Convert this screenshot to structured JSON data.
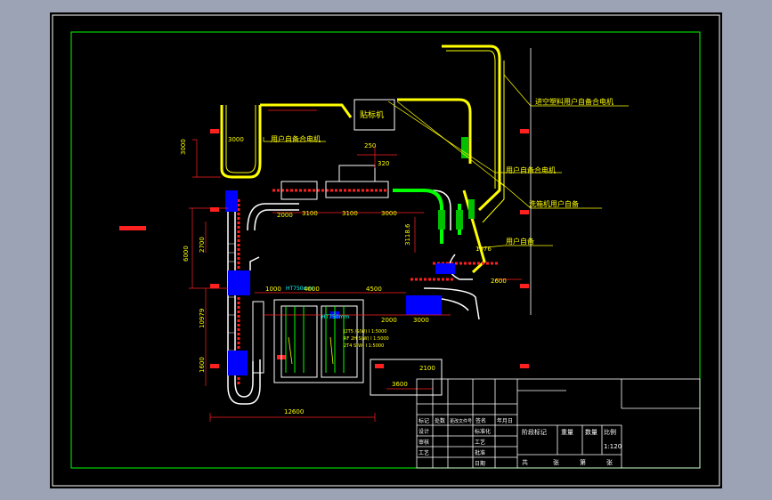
{
  "drawing": {
    "callouts": {
      "vacuum_oiler_motor": "进空塑料用户自备合电机",
      "own_motor_a": "用户自备合电机",
      "own_motor_b": "用户自备合电机",
      "washer_own": "洗箱机用户自备",
      "user_own": "用户自备"
    },
    "machine_label": "贴标机",
    "dims": {
      "d3000_a": "3000",
      "d3000_v": "3000",
      "d250": "250",
      "d320": "320",
      "d2000": "2000",
      "d3100": "3100",
      "d3100b": "3100",
      "d3000_b": "3000",
      "d3118_v": "3118.6",
      "d6000_v": "6000",
      "d2700_v": "2700",
      "d10979_v": "10979",
      "d1600_v": "1600",
      "d4000": "4000",
      "d4500": "4500",
      "d1000": "1000",
      "d2000b": "2000",
      "d3000_c": "3000",
      "d2100": "2100",
      "d12600": "12600",
      "d3600": "3600",
      "d2600": "2600",
      "d1076": "1076",
      "ht750": "HT750mm",
      "ht750b": "HT750mm",
      "note1": "J2T5 /S(W) I 1:5000",
      "note2": "RF 2H S(W) I 1:5000",
      "note3": "2T4 S(W) I 1:5000"
    },
    "title_block": {
      "row1": [
        "标记",
        "处数",
        "更改文件号",
        "签名",
        "年月日"
      ],
      "design": "设计",
      "std": "标准化",
      "check": "审核",
      "craft": "工艺",
      "process": "工艺",
      "approve": "批准",
      "date": "日期",
      "stage": "阶段标记",
      "weight": "重量",
      "qty": "数量",
      "scale_label": "比例",
      "scale_value": "1:120",
      "total": "共",
      "sheets": "张",
      "sheet_no": "第",
      "sheet_unit": "张"
    }
  }
}
